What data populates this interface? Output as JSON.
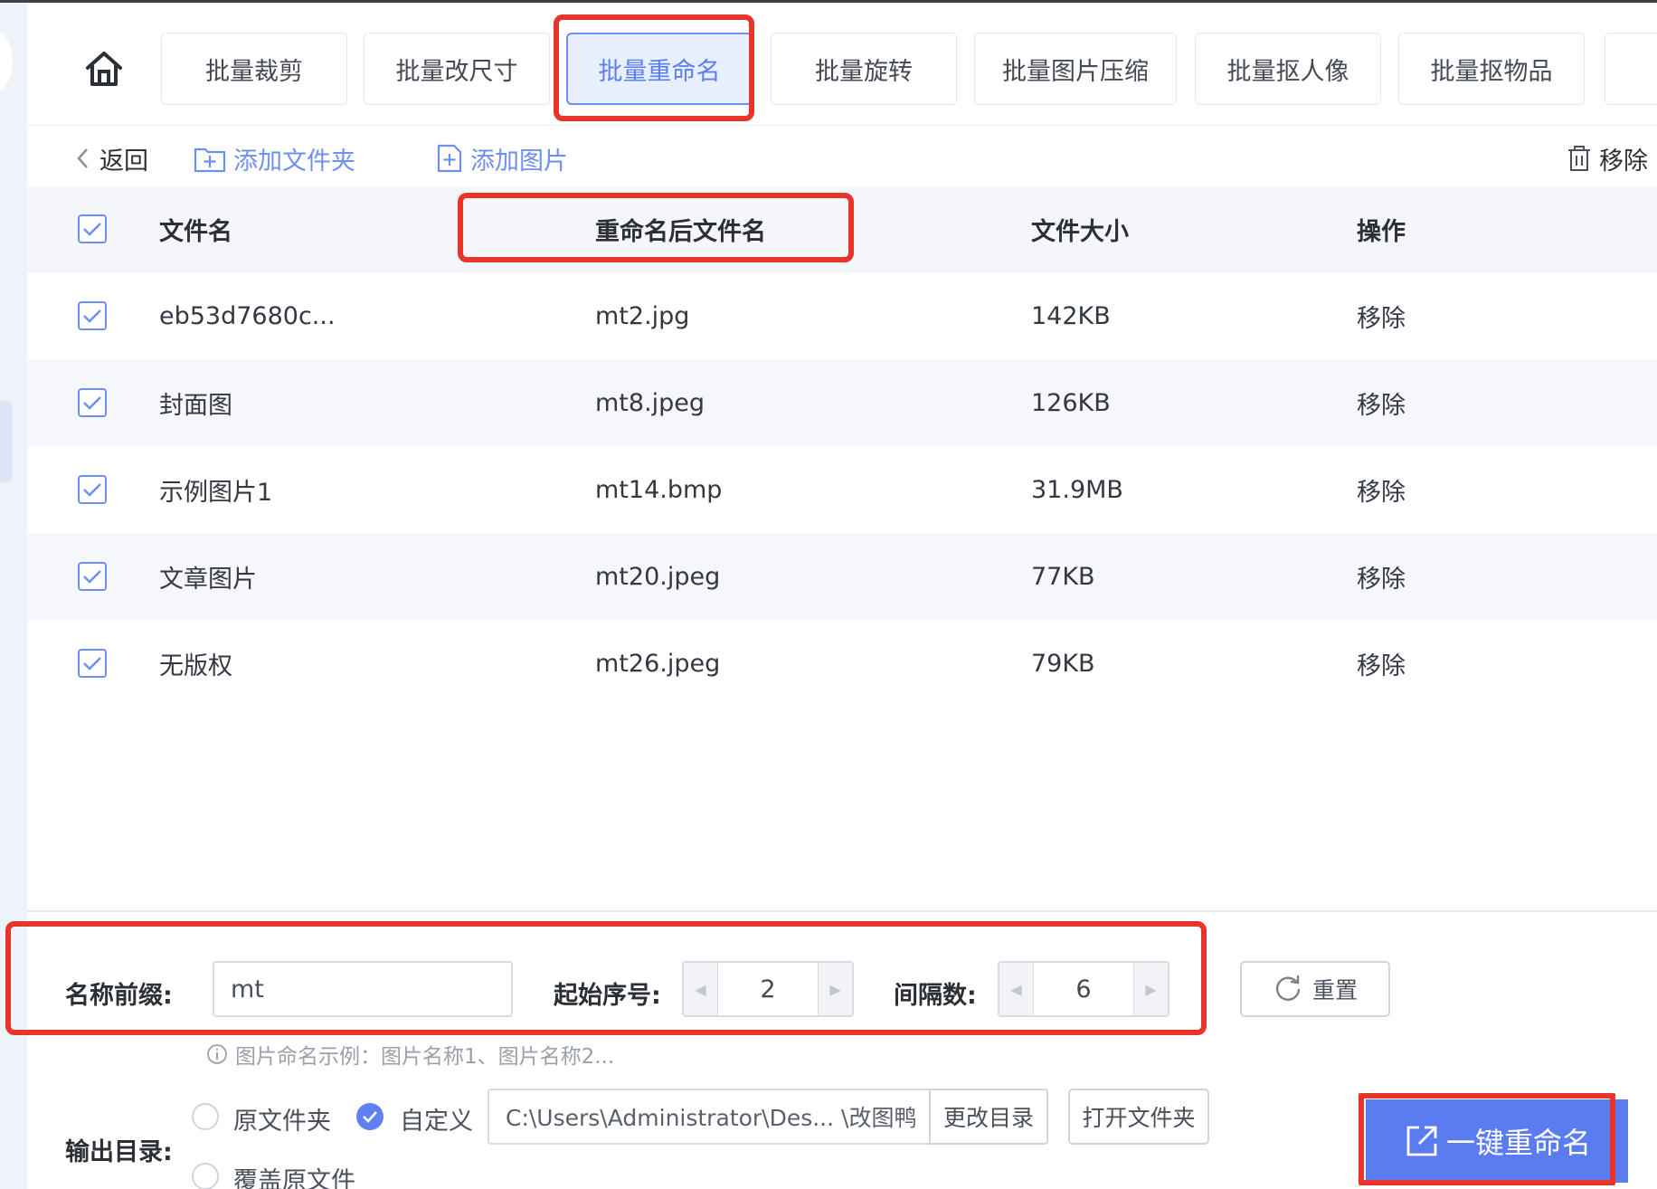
{
  "tabs": [
    {
      "label": "批量裁剪",
      "active": false
    },
    {
      "label": "批量改尺寸",
      "active": false
    },
    {
      "label": "批量重命名",
      "active": true
    },
    {
      "label": "批量旋转",
      "active": false
    },
    {
      "label": "批量图片压缩",
      "active": false
    },
    {
      "label": "批量抠人像",
      "active": false
    },
    {
      "label": "批量抠物品",
      "active": false
    }
  ],
  "toolbar": {
    "back": "返回",
    "add_folder": "添加文件夹",
    "add_image": "添加图片",
    "remove": "移除"
  },
  "table": {
    "headers": {
      "filename": "文件名",
      "renamed": "重命名后文件名",
      "size": "文件大小",
      "action": "操作"
    },
    "rows": [
      {
        "filename": "eb53d7680c...",
        "renamed": "mt2.jpg",
        "size": "142KB",
        "action": "移除"
      },
      {
        "filename": "封面图",
        "renamed": "mt8.jpeg",
        "size": "126KB",
        "action": "移除"
      },
      {
        "filename": "示例图片1",
        "renamed": "mt14.bmp",
        "size": "31.9MB",
        "action": "移除"
      },
      {
        "filename": "文章图片",
        "renamed": "mt20.jpeg",
        "size": "77KB",
        "action": "移除"
      },
      {
        "filename": "无版权",
        "renamed": "mt26.jpeg",
        "size": "79KB",
        "action": "移除"
      }
    ]
  },
  "form": {
    "prefix_label": "名称前缀:",
    "prefix_value": "mt",
    "start_label": "起始序号:",
    "start_value": "2",
    "interval_label": "间隔数:",
    "interval_value": "6",
    "reset": "重置",
    "hint": "图片命名示例：图片名称1、图片名称2..."
  },
  "output": {
    "label": "输出目录:",
    "option_original": "原文件夹",
    "option_custom": "自定义",
    "option_overwrite": "覆盖原文件",
    "selected": "自定义",
    "path": "C:\\Users\\Administrator\\Des... \\改图鸭",
    "change_dir": "更改目录",
    "open_folder": "打开文件夹"
  },
  "primary_button": "一键重命名",
  "colors": {
    "accent": "#5b7cf0",
    "highlight": "#e8352a",
    "checkbox": "#6d8ff0"
  }
}
